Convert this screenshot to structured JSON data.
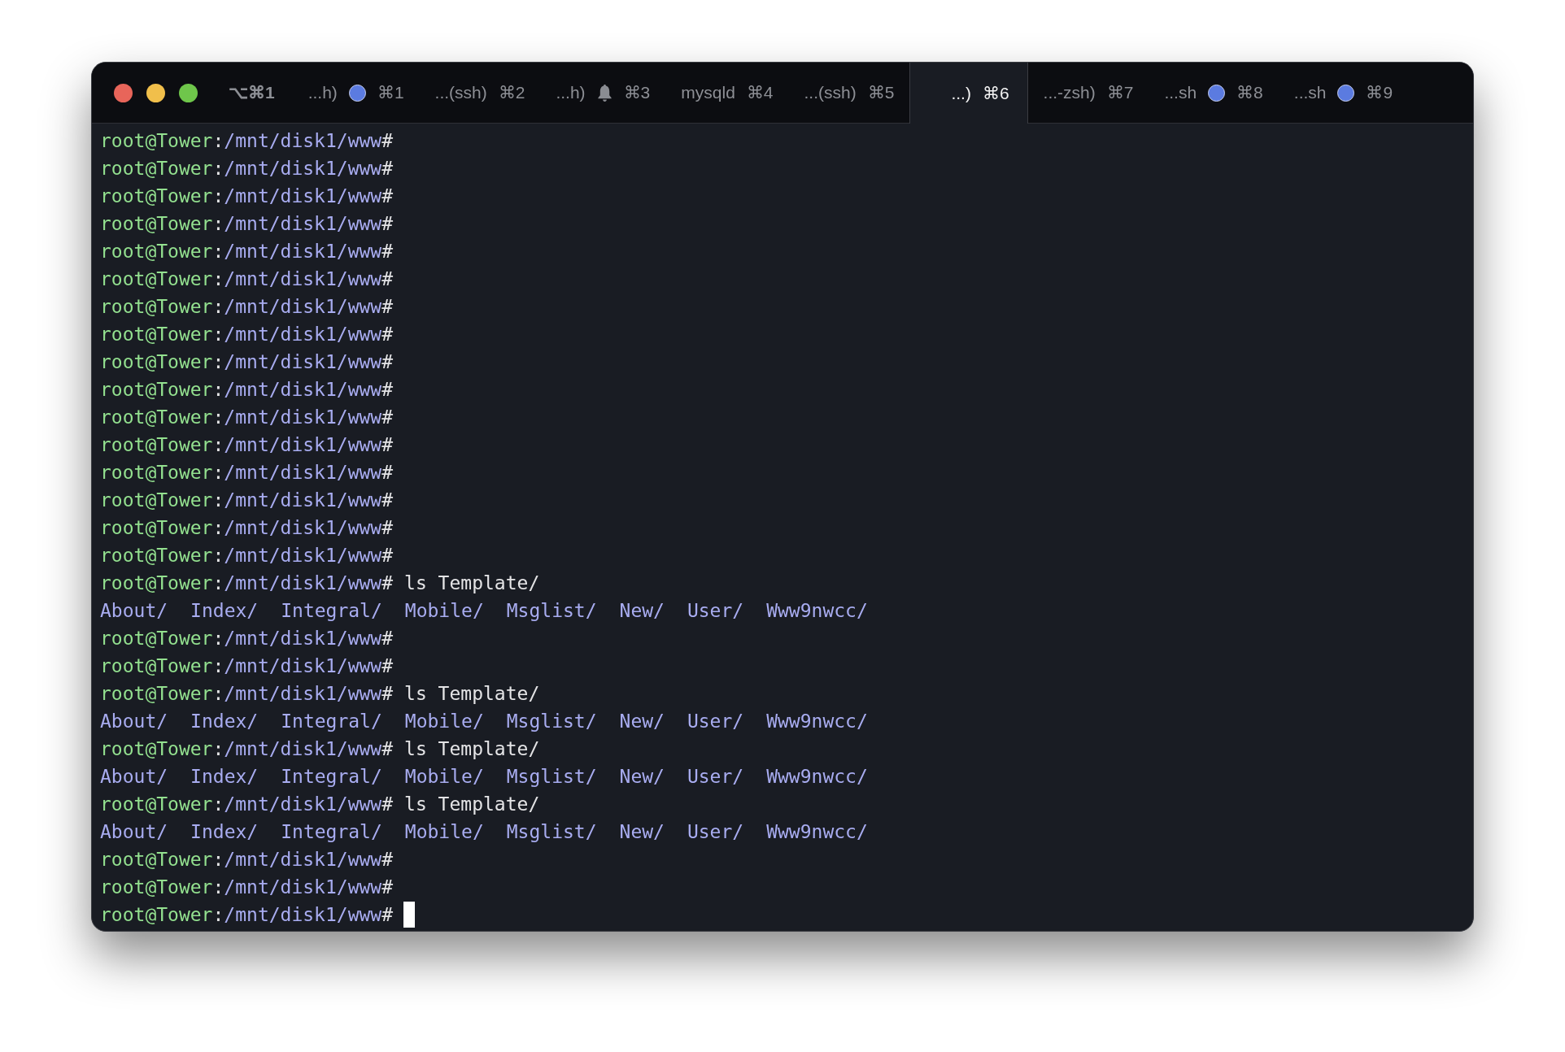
{
  "window": {
    "tabs": [
      {
        "label": "⌥⌘1",
        "kind": "plain",
        "selected": false
      },
      {
        "label": "...h)",
        "kind": "dot",
        "shortcut": "⌘1",
        "selected": false
      },
      {
        "label": "...(ssh)",
        "kind": "plain",
        "shortcut": "⌘2",
        "selected": false
      },
      {
        "label": "...h)",
        "kind": "bell",
        "shortcut": "⌘3",
        "selected": false
      },
      {
        "label": "mysqld",
        "kind": "plain",
        "shortcut": "⌘4",
        "selected": false
      },
      {
        "label": "...(ssh)",
        "kind": "plain",
        "shortcut": "⌘5",
        "selected": false
      },
      {
        "label": "...)",
        "kind": "plain",
        "shortcut": "⌘6",
        "selected": true
      },
      {
        "label": "...-zsh)",
        "kind": "plain",
        "shortcut": "⌘7",
        "selected": false
      },
      {
        "label": "...sh",
        "kind": "dot",
        "shortcut": "⌘8",
        "selected": false
      },
      {
        "label": "...sh",
        "kind": "dot",
        "shortcut": "⌘9",
        "selected": false
      }
    ]
  },
  "terminal": {
    "lines": [
      {
        "kind": "prompt",
        "user": "root@Tower",
        "sep": ":",
        "path": "/mnt/disk1/www",
        "mark": "#"
      },
      {
        "kind": "prompt",
        "user": "root@Tower",
        "sep": ":",
        "path": "/mnt/disk1/www",
        "mark": "#"
      },
      {
        "kind": "prompt",
        "user": "root@Tower",
        "sep": ":",
        "path": "/mnt/disk1/www",
        "mark": "#"
      },
      {
        "kind": "prompt",
        "user": "root@Tower",
        "sep": ":",
        "path": "/mnt/disk1/www",
        "mark": "#"
      },
      {
        "kind": "prompt",
        "user": "root@Tower",
        "sep": ":",
        "path": "/mnt/disk1/www",
        "mark": "#"
      },
      {
        "kind": "prompt",
        "user": "root@Tower",
        "sep": ":",
        "path": "/mnt/disk1/www",
        "mark": "#"
      },
      {
        "kind": "prompt",
        "user": "root@Tower",
        "sep": ":",
        "path": "/mnt/disk1/www",
        "mark": "#"
      },
      {
        "kind": "prompt",
        "user": "root@Tower",
        "sep": ":",
        "path": "/mnt/disk1/www",
        "mark": "#"
      },
      {
        "kind": "prompt",
        "user": "root@Tower",
        "sep": ":",
        "path": "/mnt/disk1/www",
        "mark": "#"
      },
      {
        "kind": "prompt",
        "user": "root@Tower",
        "sep": ":",
        "path": "/mnt/disk1/www",
        "mark": "#"
      },
      {
        "kind": "prompt",
        "user": "root@Tower",
        "sep": ":",
        "path": "/mnt/disk1/www",
        "mark": "#"
      },
      {
        "kind": "prompt",
        "user": "root@Tower",
        "sep": ":",
        "path": "/mnt/disk1/www",
        "mark": "#"
      },
      {
        "kind": "prompt",
        "user": "root@Tower",
        "sep": ":",
        "path": "/mnt/disk1/www",
        "mark": "#"
      },
      {
        "kind": "prompt",
        "user": "root@Tower",
        "sep": ":",
        "path": "/mnt/disk1/www",
        "mark": "#"
      },
      {
        "kind": "prompt",
        "user": "root@Tower",
        "sep": ":",
        "path": "/mnt/disk1/www",
        "mark": "#"
      },
      {
        "kind": "prompt",
        "user": "root@Tower",
        "sep": ":",
        "path": "/mnt/disk1/www",
        "mark": "#"
      },
      {
        "kind": "prompt",
        "user": "root@Tower",
        "sep": ":",
        "path": "/mnt/disk1/www",
        "mark": "#",
        "command": "ls Template/"
      },
      {
        "kind": "listing",
        "entries": [
          "About/",
          "Index/",
          "Integral/",
          "Mobile/",
          "Msglist/",
          "New/",
          "User/",
          "Www9nwcc/"
        ]
      },
      {
        "kind": "prompt",
        "user": "root@Tower",
        "sep": ":",
        "path": "/mnt/disk1/www",
        "mark": "#"
      },
      {
        "kind": "prompt",
        "user": "root@Tower",
        "sep": ":",
        "path": "/mnt/disk1/www",
        "mark": "#"
      },
      {
        "kind": "prompt",
        "user": "root@Tower",
        "sep": ":",
        "path": "/mnt/disk1/www",
        "mark": "#",
        "command": "ls Template/"
      },
      {
        "kind": "listing",
        "entries": [
          "About/",
          "Index/",
          "Integral/",
          "Mobile/",
          "Msglist/",
          "New/",
          "User/",
          "Www9nwcc/"
        ]
      },
      {
        "kind": "prompt",
        "user": "root@Tower",
        "sep": ":",
        "path": "/mnt/disk1/www",
        "mark": "#",
        "command": "ls Template/"
      },
      {
        "kind": "listing",
        "entries": [
          "About/",
          "Index/",
          "Integral/",
          "Mobile/",
          "Msglist/",
          "New/",
          "User/",
          "Www9nwcc/"
        ]
      },
      {
        "kind": "prompt",
        "user": "root@Tower",
        "sep": ":",
        "path": "/mnt/disk1/www",
        "mark": "#",
        "command": "ls Template/"
      },
      {
        "kind": "listing",
        "entries": [
          "About/",
          "Index/",
          "Integral/",
          "Mobile/",
          "Msglist/",
          "New/",
          "User/",
          "Www9nwcc/"
        ]
      },
      {
        "kind": "prompt",
        "user": "root@Tower",
        "sep": ":",
        "path": "/mnt/disk1/www",
        "mark": "#"
      },
      {
        "kind": "prompt",
        "user": "root@Tower",
        "sep": ":",
        "path": "/mnt/disk1/www",
        "mark": "#"
      },
      {
        "kind": "prompt",
        "user": "root@Tower",
        "sep": ":",
        "path": "/mnt/disk1/www",
        "mark": "#",
        "cursor": true
      }
    ]
  }
}
